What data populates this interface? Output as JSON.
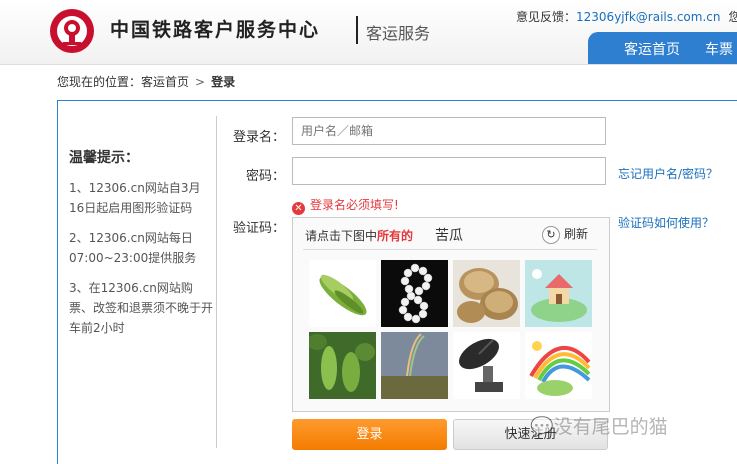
{
  "header": {
    "title": "中国铁路客户服务中心",
    "subtitle": "客运服务",
    "feedback_label": "意见反馈：",
    "feedback_email": "12306yjfk@rails.com.cn",
    "greeting": "您好",
    "nav": [
      "客运首页",
      "车票"
    ]
  },
  "breadcrumb": {
    "prefix": "您现在的位置：",
    "home": "客运首页",
    "separator": ">",
    "current": "登录"
  },
  "tips": {
    "title": "温馨提示：",
    "items": [
      "1、12306.cn网站自3月16日起启用图形验证码",
      "2、12306.cn网站每日07:00~23:00提供服务",
      "3、在12306.cn网站购票、改签和退票须不晚于开车前2小时"
    ]
  },
  "form": {
    "username_label": "登录名：",
    "username_placeholder": "用户名／邮箱",
    "password_label": "密码：",
    "forgot_link": "忘记用户名/密码？",
    "error_text": "登录名必须填写!",
    "captcha_label": "验证码：",
    "captcha_help_link": "验证码如何使用？"
  },
  "captcha": {
    "prompt_pre": "请点击下图中",
    "prompt_em": "所有的",
    "target_word": "苦瓜",
    "refresh_label": "刷新",
    "tiles": [
      "bitter-melon",
      "pearl-necklace",
      "bamboo-steamer",
      "cartoon-house",
      "bitter-melon-vine",
      "rainbow-field",
      "radar-dish",
      "cartoon-rainbow"
    ]
  },
  "buttons": {
    "login": "登录",
    "register": "快速注册"
  },
  "watermark": "没有尾巴的猫",
  "colors": {
    "accent": "#2e7fd0",
    "brand_red": "#c8102e",
    "login_orange": "#f47c00",
    "error": "#e4393c",
    "link": "#1a6fbd"
  }
}
